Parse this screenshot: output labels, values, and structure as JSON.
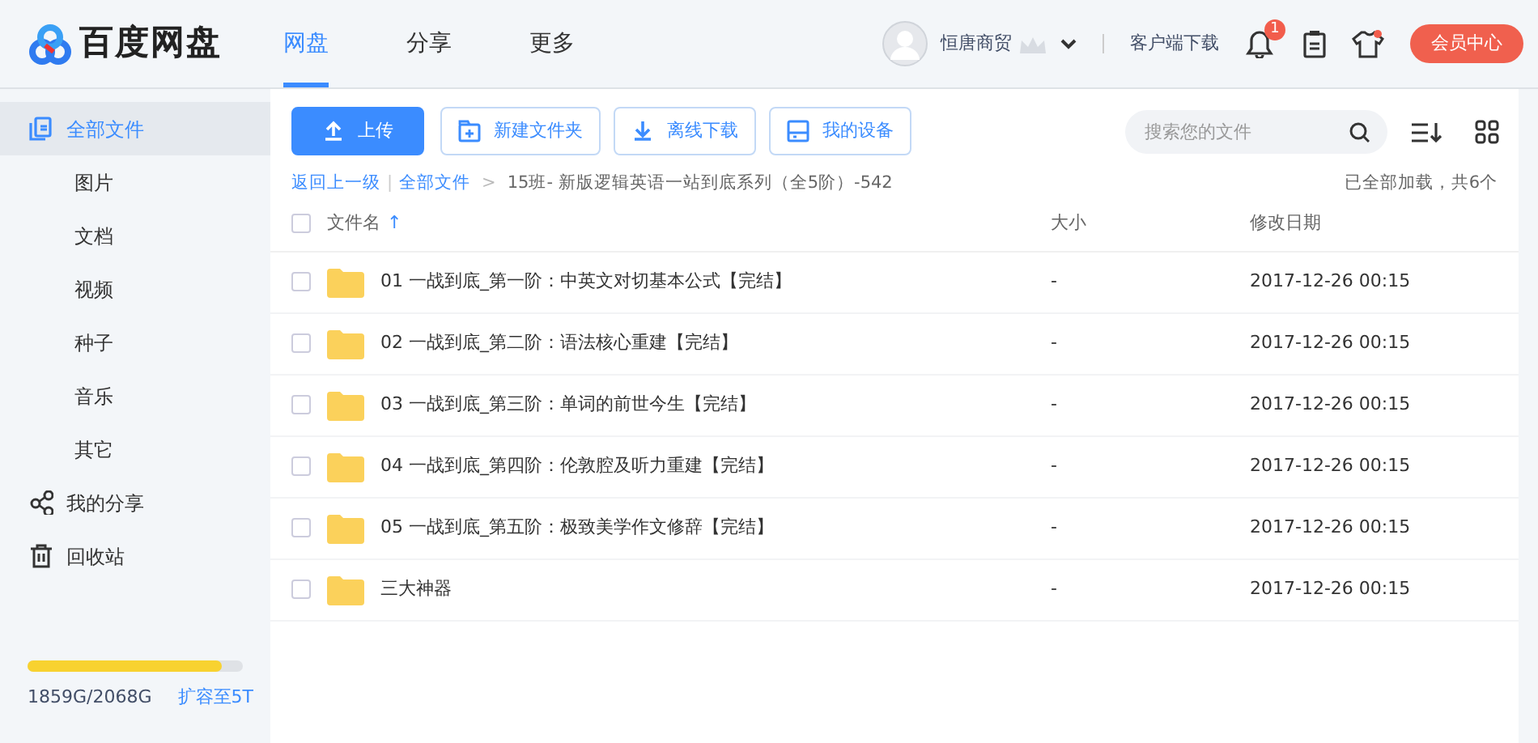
{
  "header": {
    "logo_text": "百度网盘",
    "tabs": [
      {
        "label": "网盘",
        "selected": true
      },
      {
        "label": "分享",
        "selected": false
      },
      {
        "label": "更多",
        "selected": false
      }
    ],
    "user_name": "恒唐商贸",
    "client_download": "客户端下载",
    "notification_badge": "1",
    "vip_button": "会员中心"
  },
  "sidebar": {
    "items": [
      {
        "label": "全部文件",
        "kind": "icon",
        "selected": true,
        "children": [
          {
            "label": "图片",
            "selected": false
          },
          {
            "label": "文档",
            "selected": false
          },
          {
            "label": "视频",
            "selected": false
          },
          {
            "label": "种子",
            "selected": false
          },
          {
            "label": "音乐",
            "selected": false
          },
          {
            "label": "其它",
            "selected": false
          }
        ]
      },
      {
        "label": "我的分享",
        "kind": "icon",
        "selected": false
      },
      {
        "label": "回收站",
        "kind": "icon",
        "selected": false
      }
    ],
    "storage": {
      "level": 0.9,
      "usage": "1859G/2068G",
      "upgrade_link": "扩容至5T"
    }
  },
  "toolbar": {
    "buttons": [
      {
        "label": "上传",
        "kind": "primary"
      },
      {
        "label": "新建文件夹",
        "kind": "outline"
      },
      {
        "label": "离线下载",
        "kind": "outline"
      },
      {
        "label": "我的设备",
        "kind": "outline"
      }
    ],
    "search": {
      "placeholder": "搜索您的文件"
    }
  },
  "breadcrumb": {
    "back": "返回上一级",
    "separator": "|",
    "root": "全部文件",
    "arrow": ">",
    "current": "15班- 新版逻辑英语一站到底系列（全5阶）-542",
    "status": "已全部加载，共6个"
  },
  "table": {
    "select_all_checked": false,
    "columns": [
      {
        "label": "文件名",
        "sort_indicator": "↑"
      },
      {
        "label": "大小"
      },
      {
        "label": "修改日期"
      }
    ],
    "rows": [
      {
        "name": "01 一战到底_第一阶：中英文对切基本公式【完结】",
        "size": "-",
        "modified": "2017-12-26 00:15",
        "checked": false
      },
      {
        "name": "02 一战到底_第二阶：语法核心重建【完结】",
        "size": "-",
        "modified": "2017-12-26 00:15",
        "checked": false
      },
      {
        "name": "03 一战到底_第三阶：单词的前世今生【完结】",
        "size": "-",
        "modified": "2017-12-26 00:15",
        "checked": false
      },
      {
        "name": "04 一战到底_第四阶：伦敦腔及听力重建【完结】",
        "size": "-",
        "modified": "2017-12-26 00:15",
        "checked": false
      },
      {
        "name": "05 一战到底_第五阶：极致美学作文修辞【完结】",
        "size": "-",
        "modified": "2017-12-26 00:15",
        "checked": false
      },
      {
        "name": "三大神器",
        "size": "-",
        "modified": "2017-12-26 00:15",
        "checked": false
      }
    ]
  }
}
